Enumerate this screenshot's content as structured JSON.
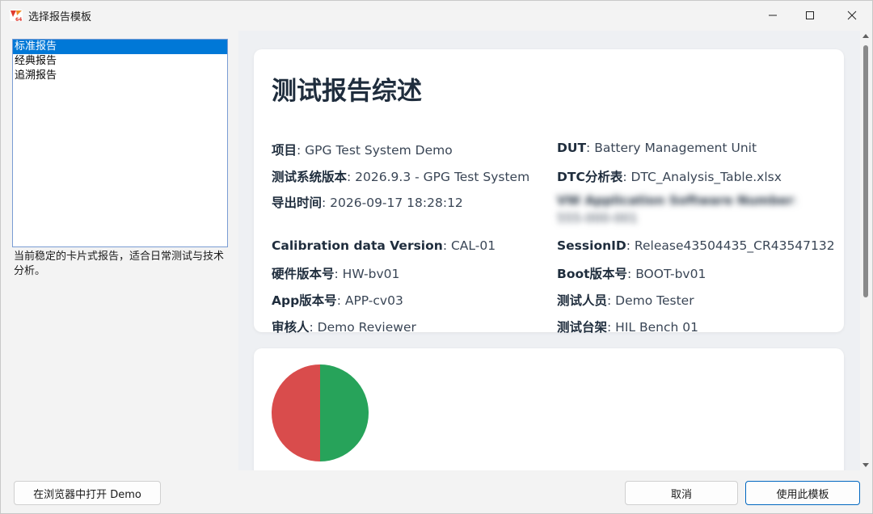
{
  "window": {
    "title": "选择报告模板",
    "icon": "app-logo-icon"
  },
  "templates": {
    "items": [
      {
        "label": "标准报告",
        "selected": true
      },
      {
        "label": "经典报告",
        "selected": false
      },
      {
        "label": "追溯报告",
        "selected": false
      }
    ],
    "description": "当前稳定的卡片式报告，适合日常测试与技术分析。"
  },
  "report": {
    "title": "测试报告综述",
    "fields": {
      "project": {
        "key": "项目",
        "value": "GPG Test System Demo"
      },
      "system_version": {
        "key": "测试系统版本",
        "value": "2026.9.3 - GPG Test System"
      },
      "export_time": {
        "key": "导出时间",
        "value": "2026-09-17 18:28:12"
      },
      "calibration": {
        "key": "Calibration data Version",
        "value": "CAL-01"
      },
      "hardware": {
        "key": "硬件版本号",
        "value": "HW-bv01"
      },
      "app": {
        "key": "App版本号",
        "value": "APP-cv03"
      },
      "reviewer": {
        "key": "审核人",
        "value": "Demo Reviewer"
      },
      "dut": {
        "key": "DUT",
        "value": "Battery Management Unit"
      },
      "dtc": {
        "key": "DTC分析表",
        "value": "DTC_Analysis_Table.xlsx"
      },
      "vw_app": {
        "key": "VW Application Software Number",
        "value": "555-000-001"
      },
      "session": {
        "key": "SessionID",
        "value": "Release43504435_CR43547132"
      },
      "boot": {
        "key": "Boot版本号",
        "value": "BOOT-bv01"
      },
      "tester": {
        "key": "测试人员",
        "value": "Demo Tester"
      },
      "bench": {
        "key": "测试台架",
        "value": "HIL Bench 01"
      }
    },
    "pie": {
      "colors": {
        "fail": "#d94c4c",
        "pass": "#27a35a"
      },
      "fractions": {
        "fail": 0.5,
        "pass": 0.5
      }
    }
  },
  "buttons": {
    "open_demo": "在浏览器中打开 Demo",
    "cancel": "取消",
    "use_template": "使用此模板"
  }
}
